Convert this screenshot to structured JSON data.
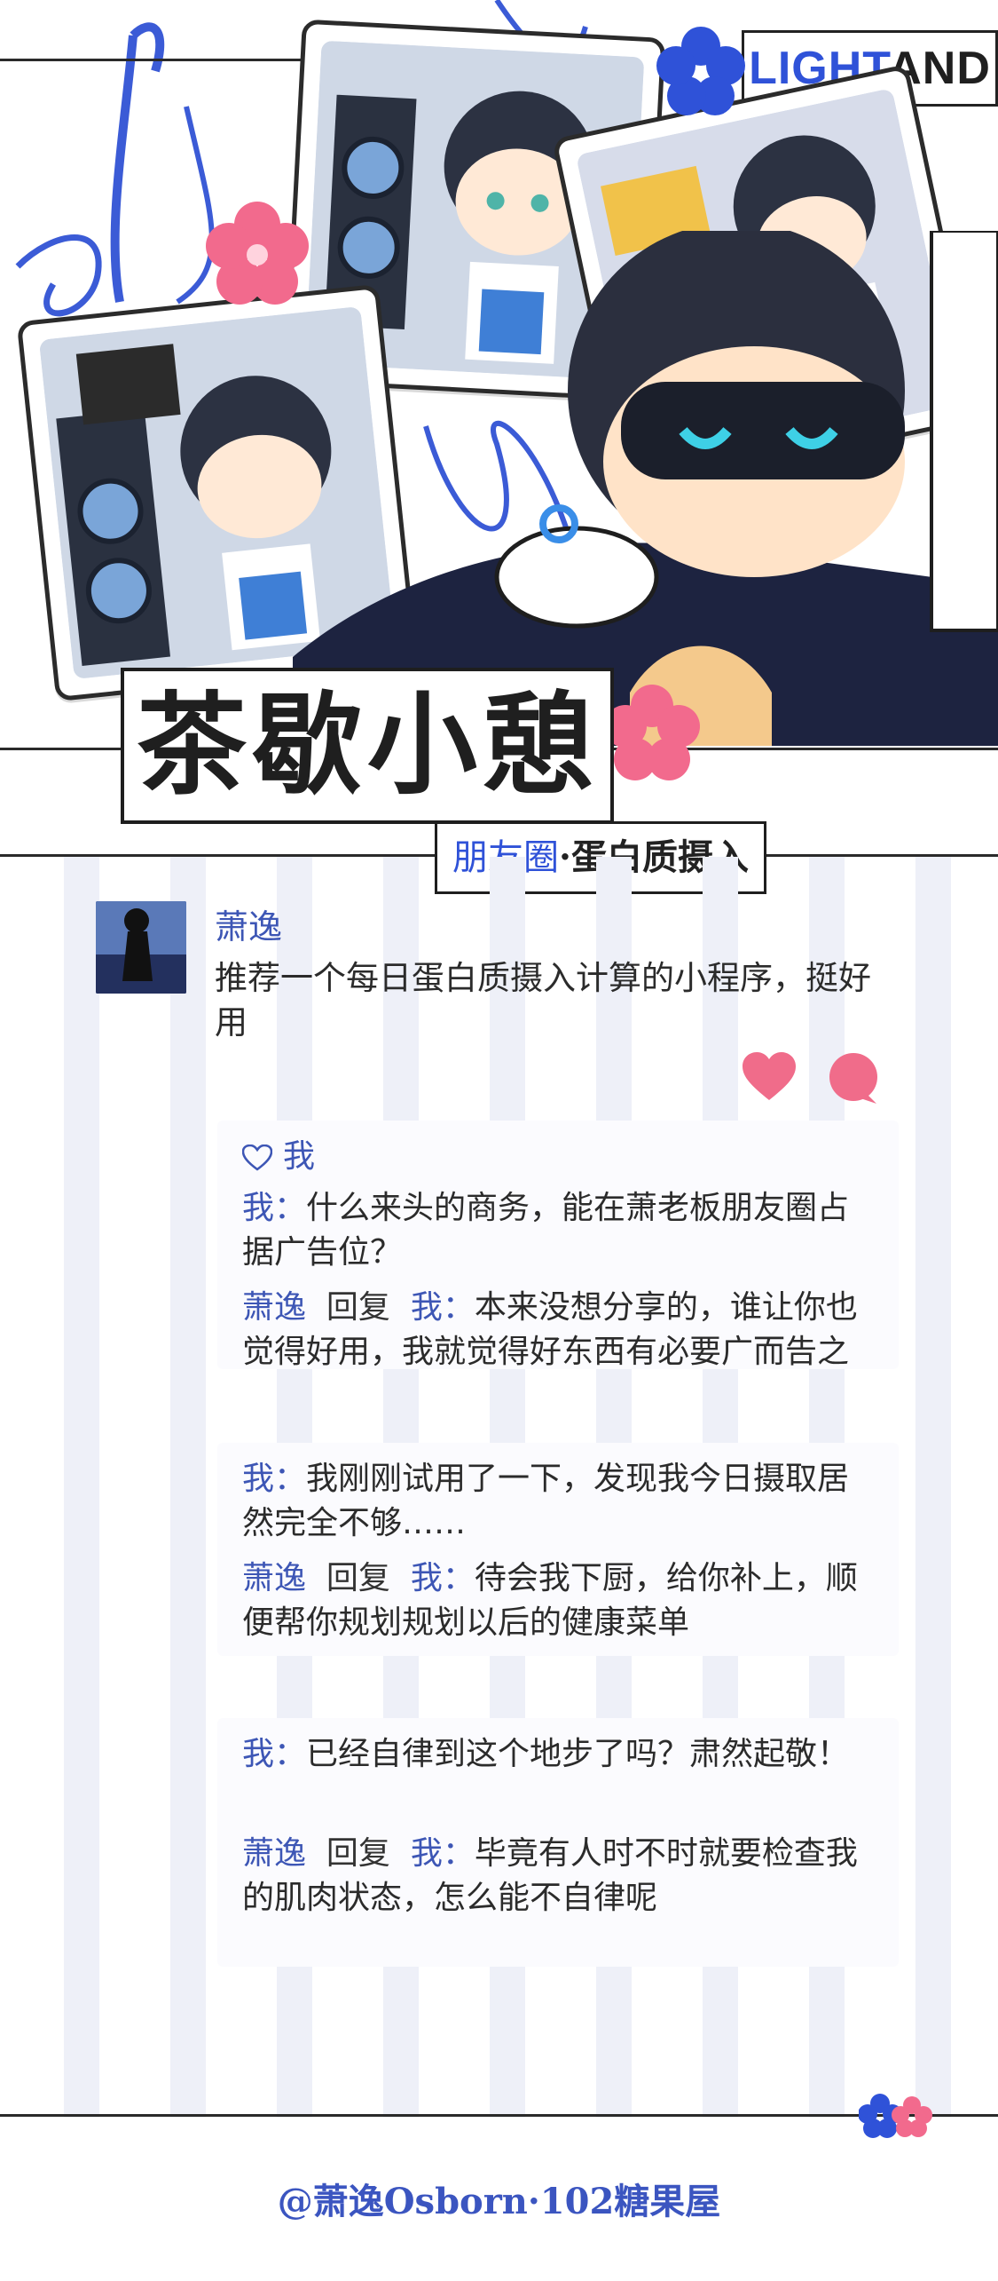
{
  "brand": {
    "part1": "LIGHT",
    "part2": "AND"
  },
  "banner_title": "茶歇小憩",
  "subtitle": {
    "highlight": "朋友圈",
    "rest": "·蛋白质摄入"
  },
  "post": {
    "author": "萧逸",
    "text": "推荐一个每日蛋白质摄入计算的小程序，挺好用"
  },
  "likes": {
    "name": "我"
  },
  "comments": [
    {
      "from": "我：",
      "text": "什么来头的商务，能在萧老板朋友圈占据广告位？",
      "reply_from": "萧逸",
      "reply_word": "回复",
      "reply_to": "我：",
      "reply_text": "本来没想分享的，谁让你也觉得好用，我就觉得好东西有必要广而告之"
    },
    {
      "from": "我：",
      "text": "我刚刚试用了一下，发现我今日摄取居然完全不够……",
      "reply_from": "萧逸",
      "reply_word": "回复",
      "reply_to": "我：",
      "reply_text": "待会我下厨，给你补上，顺便帮你规划规划以后的健康菜单"
    },
    {
      "from": "我：",
      "text": "已经自律到这个地步了吗？肃然起敬！",
      "reply_from": "萧逸",
      "reply_word": "回复",
      "reply_to": "我：",
      "reply_text": "毕竟有人时不时就要检查我的肌肉状态，怎么能不自律呢"
    }
  ],
  "footer": "@萧逸Osborn·102糖果屋",
  "colors": {
    "accent_blue": "#3d56b5",
    "brand_blue": "#2f52d8",
    "pink": "#f26a8d",
    "stripe": "#eef0f8"
  }
}
